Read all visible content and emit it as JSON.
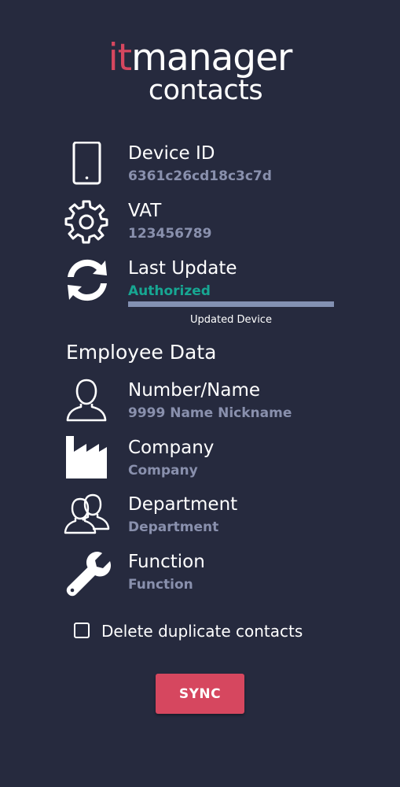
{
  "logo": {
    "it": "it",
    "manager": "manager",
    "contacts": "contacts"
  },
  "device": {
    "device_id_label": "Device ID",
    "device_id_value": "6361c26cd18c3c7d",
    "vat_label": "VAT",
    "vat_value": "123456789",
    "last_update_label": "Last Update",
    "last_update_value": "Authorized",
    "progress_caption": "Updated Device",
    "progress_percent": 100
  },
  "employee": {
    "section_title": "Employee Data",
    "number_name_label": "Number/Name",
    "number_name_value": "9999 Name Nickname",
    "company_label": "Company",
    "company_value": "Company",
    "department_label": "Department",
    "department_value": "Department",
    "function_label": "Function",
    "function_value": "Function"
  },
  "options": {
    "delete_duplicates_label": "Delete duplicate contacts",
    "delete_duplicates_checked": false
  },
  "actions": {
    "sync_label": "SYNC"
  },
  "icons": {
    "device": "smartphone-icon",
    "vat": "gear-icon",
    "last_update": "sync-icon",
    "number_name": "person-icon",
    "company": "factory-icon",
    "department": "group-icon",
    "function": "wrench-icon"
  },
  "colors": {
    "background": "#262a3e",
    "accent": "#d6475f",
    "value_text": "#8990ad",
    "authorized": "#17a692",
    "progress": "#8391b2"
  }
}
